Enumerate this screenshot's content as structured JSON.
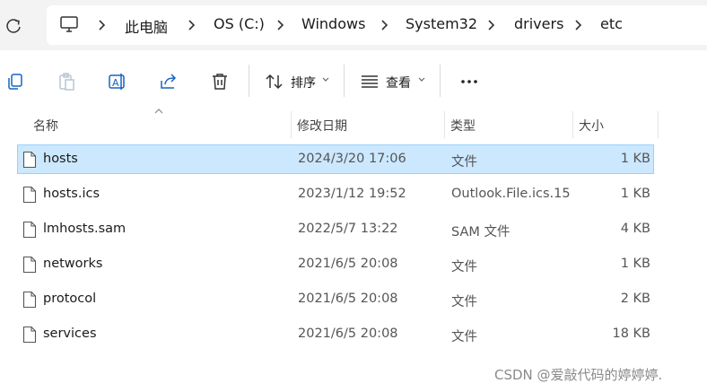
{
  "breadcrumb": [
    "此电脑",
    "OS (C:)",
    "Windows",
    "System32",
    "drivers",
    "etc"
  ],
  "toolbar": {
    "sort_label": "排序",
    "view_label": "查看"
  },
  "columns": {
    "name": "名称",
    "date": "修改日期",
    "type": "类型",
    "size": "大小"
  },
  "files": [
    {
      "name": "hosts",
      "date": "2024/3/20 17:06",
      "type": "文件",
      "size": "1 KB",
      "selected": true
    },
    {
      "name": "hosts.ics",
      "date": "2023/1/12 19:52",
      "type": "Outlook.File.ics.15",
      "size": "1 KB"
    },
    {
      "name": "lmhosts.sam",
      "date": "2022/5/7 13:22",
      "type": "SAM 文件",
      "size": "4 KB"
    },
    {
      "name": "networks",
      "date": "2021/6/5 20:08",
      "type": "文件",
      "size": "1 KB"
    },
    {
      "name": "protocol",
      "date": "2021/6/5 20:08",
      "type": "文件",
      "size": "2 KB"
    },
    {
      "name": "services",
      "date": "2021/6/5 20:08",
      "type": "文件",
      "size": "18 KB"
    }
  ],
  "watermark": "CSDN @爱敲代码的婷婷婷.",
  "colors": {
    "selection": "#cce8ff",
    "selection_border": "#99d1ff",
    "address_bg": "#f3f3f3"
  }
}
